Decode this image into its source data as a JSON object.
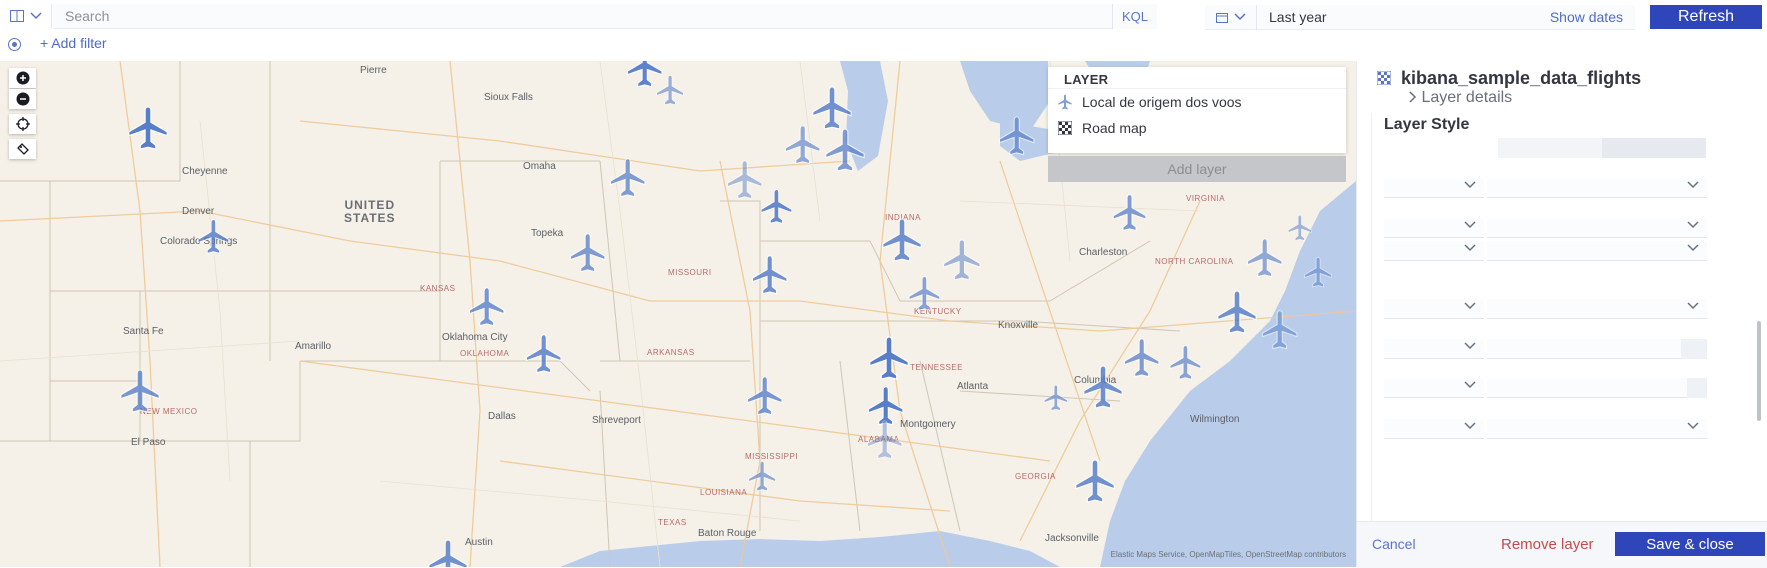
{
  "query_bar": {
    "search_placeholder": "Search",
    "language": "KQL",
    "date_range": "Last year",
    "show_dates": "Show dates",
    "refresh": "Refresh"
  },
  "filter_bar": {
    "add_filter": "+ Add filter"
  },
  "map": {
    "country_label": "UNITED\nSTATES",
    "place_labels": [
      "Pierre",
      "Sioux Falls",
      "Cheyenne",
      "Denver",
      "Colorado Springs",
      "Omaha",
      "Topeka",
      "Oklahoma City",
      "Santa Fe",
      "Amarillo",
      "Dallas",
      "Shreveport",
      "Montgomery",
      "Atlanta",
      "Columbia",
      "Charleston",
      "Knoxville",
      "Austin",
      "El Paso",
      "Jacksonville",
      "Wilmington",
      "Baton Rouge"
    ],
    "region_labels": [
      "KANSAS",
      "MISSOURI",
      "OKLAHOMA",
      "ARKANSAS",
      "MISSISSIPPI",
      "TEXAS",
      "NEW MEXICO",
      "INDIANA",
      "KENTUCKY",
      "TENNESSEE",
      "GEORGIA",
      "LOUISIANA",
      "ALABAMA",
      "VIRGINIA",
      "NORTH CAROLINA"
    ],
    "attribution": "Elastic Maps Service, OpenMapTiles, OpenStreetMap contributors",
    "plane_color": "#4f78c8"
  },
  "layer_control": {
    "title": "LAYER",
    "layers": [
      {
        "name": "Local de origem dos voos",
        "icon": "airport-icon"
      },
      {
        "name": "Road map",
        "icon": "tile-layer-icon"
      }
    ],
    "add_layer": "Add layer"
  },
  "flyout": {
    "index_name": "kibana_sample_data_flights",
    "layer_details": "Layer details",
    "layer_style": "Layer Style",
    "cancel": "Cancel",
    "remove_layer": "Remove layer",
    "save_close": "Save & close"
  },
  "colors": {
    "primary": "#2f46ba",
    "link": "#4e6bc9",
    "danger": "#c44a4a",
    "water": "#b9cdea",
    "land": "#f5f1e8"
  }
}
